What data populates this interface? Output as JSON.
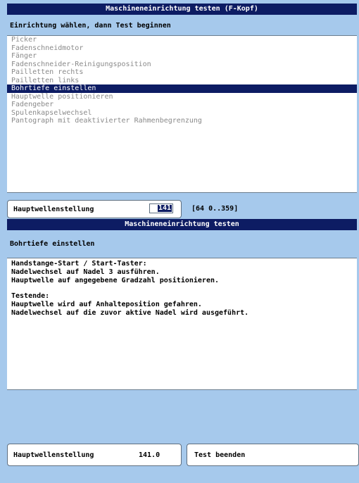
{
  "panel_top": {
    "title": "Maschineneinrichtung testen (F-Kopf)",
    "instruction": "Einrichtung wählen, dann Test beginnen",
    "items": [
      "Picker",
      "Fadenschneidmotor",
      "Fänger",
      "Fadenschneider-Reinigungsposition",
      "Pailletten rechts",
      "Pailletten links",
      "Bohrtiefe einstellen",
      "Hauptwelle positionieren",
      "Fadengeber",
      "Spulenkapselwechsel",
      "Pantograph mit deaktivierter Rahmenbegrenzung"
    ],
    "selected_index": 6,
    "param_label": "Hauptwellenstellung",
    "param_value": "141",
    "param_range": "[64  0..359]"
  },
  "panel_bottom": {
    "title": "Maschineneinrichtung testen",
    "heading": "Bohrtiefe einstellen",
    "lines": [
      "Handstange-Start / Start-Taster:",
      "Nadelwechsel auf Nadel 3 ausführen.",
      "Hauptwelle auf angegebene Gradzahl positionieren.",
      "",
      "Testende:",
      "Hauptwelle wird auf Anhalteposition gefahren.",
      "Nadelwechsel auf die zuvor aktive Nadel wird ausgeführt."
    ],
    "status_label": "Hauptwellenstellung",
    "status_value": "141.0",
    "end_button": "Test beenden"
  }
}
